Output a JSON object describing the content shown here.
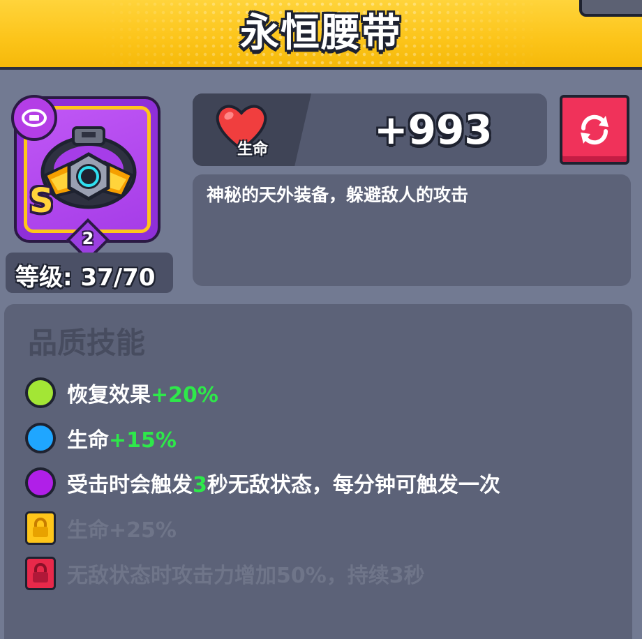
{
  "header": {
    "title": "永恒腰带"
  },
  "item": {
    "grade": "S",
    "stars": "2",
    "level_text": "等级: 37/70"
  },
  "stat": {
    "label": "生命",
    "value": "+993"
  },
  "description": "神秘的天外装备，躲避敌人的攻击",
  "skills": {
    "title": "品质技能",
    "items": [
      {
        "text": "恢复效果",
        "bonus": "+20%",
        "color": "#a3e635",
        "locked": false
      },
      {
        "text": "生命",
        "bonus": "+15%",
        "color": "#1fa6ff",
        "locked": false
      },
      {
        "pre": "受击时会触发",
        "num": "3",
        "post": "秒无敌状态，每分钟可触发一次",
        "color": "#b01fe8",
        "locked": false
      },
      {
        "text": "生命+25%",
        "color": "#ffc61a",
        "locked": true
      },
      {
        "text": "无敌状态时攻击力增加50%，持续3秒",
        "color": "#e8294a",
        "locked": true
      }
    ]
  },
  "colors": {
    "header": "#fcc419",
    "background": "#727a92",
    "accent_green": "#2ee84a",
    "reroll": "#f0325a"
  },
  "icons": [
    "belt-type-icon",
    "belt-item-icon",
    "heart-icon",
    "refresh-icon",
    "lock-icon"
  ]
}
